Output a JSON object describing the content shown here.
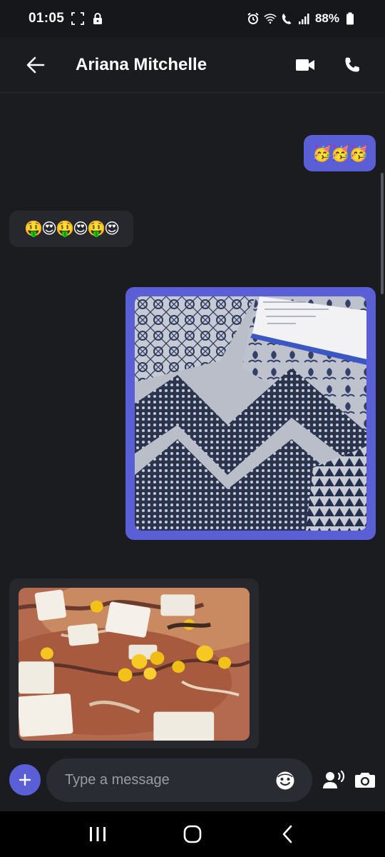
{
  "status_bar": {
    "time": "01:05",
    "battery": "88%"
  },
  "header": {
    "contact_name": "Ariana Mitchelle"
  },
  "messages": [
    {
      "direction": "outgoing",
      "type": "emoji",
      "text": "🥳🥳🥳"
    },
    {
      "direction": "incoming",
      "type": "emoji",
      "text": "🤑😍🤑😍🤑😍"
    },
    {
      "direction": "outgoing",
      "type": "image"
    },
    {
      "direction": "incoming",
      "type": "image"
    }
  ],
  "composer": {
    "placeholder": "Type a message"
  },
  "colors": {
    "accent": "#5a5fd6",
    "background": "#1b1c20",
    "incoming_bubble": "#26282e"
  }
}
